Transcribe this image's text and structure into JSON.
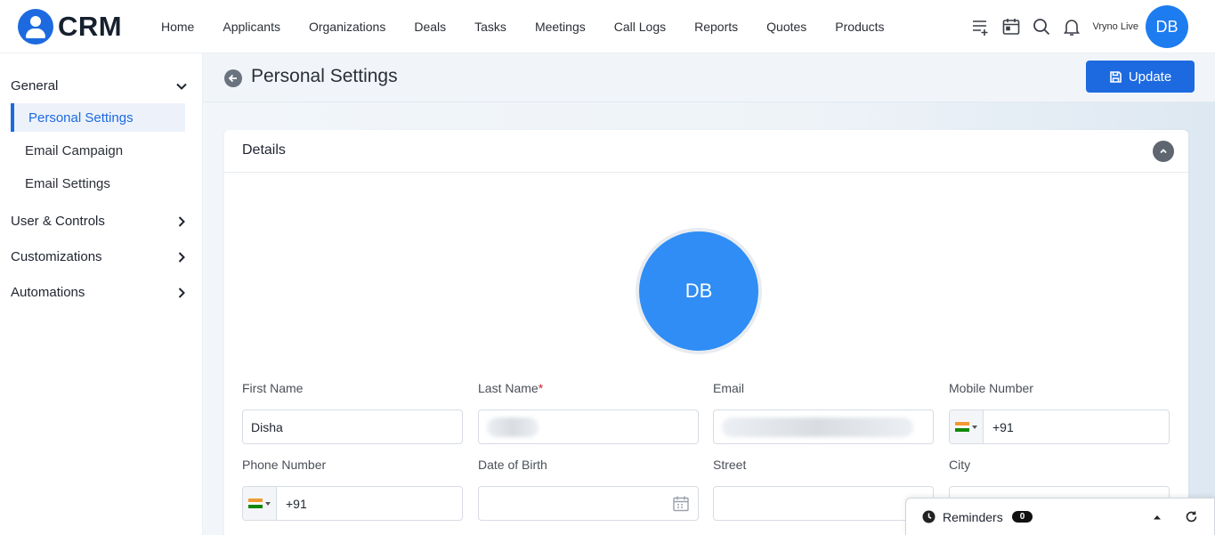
{
  "app": {
    "logo_text": "CRM",
    "org_name": "Vryno Live",
    "user_initials": "DB"
  },
  "nav": [
    "Home",
    "Applicants",
    "Organizations",
    "Deals",
    "Tasks",
    "Meetings",
    "Call Logs",
    "Reports",
    "Quotes",
    "Products"
  ],
  "top_icons": [
    "add-list-icon",
    "calendar-icon",
    "search-icon",
    "bell-icon"
  ],
  "sidebar": {
    "general_label": "General",
    "sub_items": [
      "Personal Settings",
      "Email Campaign",
      "Email Settings"
    ],
    "active_sub_item": "Personal Settings",
    "groups": [
      "User & Controls",
      "Customizations",
      "Automations"
    ]
  },
  "page": {
    "title": "Personal Settings",
    "update_label": "Update"
  },
  "details": {
    "title": "Details",
    "avatar_initials": "DB",
    "fields": {
      "first_name": {
        "label": "First Name",
        "value": "Disha"
      },
      "last_name": {
        "label": "Last Name",
        "required_mark": "*",
        "value": ""
      },
      "email": {
        "label": "Email",
        "value": ""
      },
      "mobile_number": {
        "label": "Mobile Number",
        "code": "+91"
      },
      "phone_number": {
        "label": "Phone Number",
        "code": "+91"
      },
      "date_of_birth": {
        "label": "Date of Birth",
        "value": ""
      },
      "street": {
        "label": "Street",
        "value": ""
      },
      "city": {
        "label": "City",
        "value": ""
      }
    }
  },
  "reminders": {
    "label": "Reminders",
    "count": "0"
  },
  "colors": {
    "brand": "#1d6ae0",
    "avatar": "#2f8df5"
  }
}
